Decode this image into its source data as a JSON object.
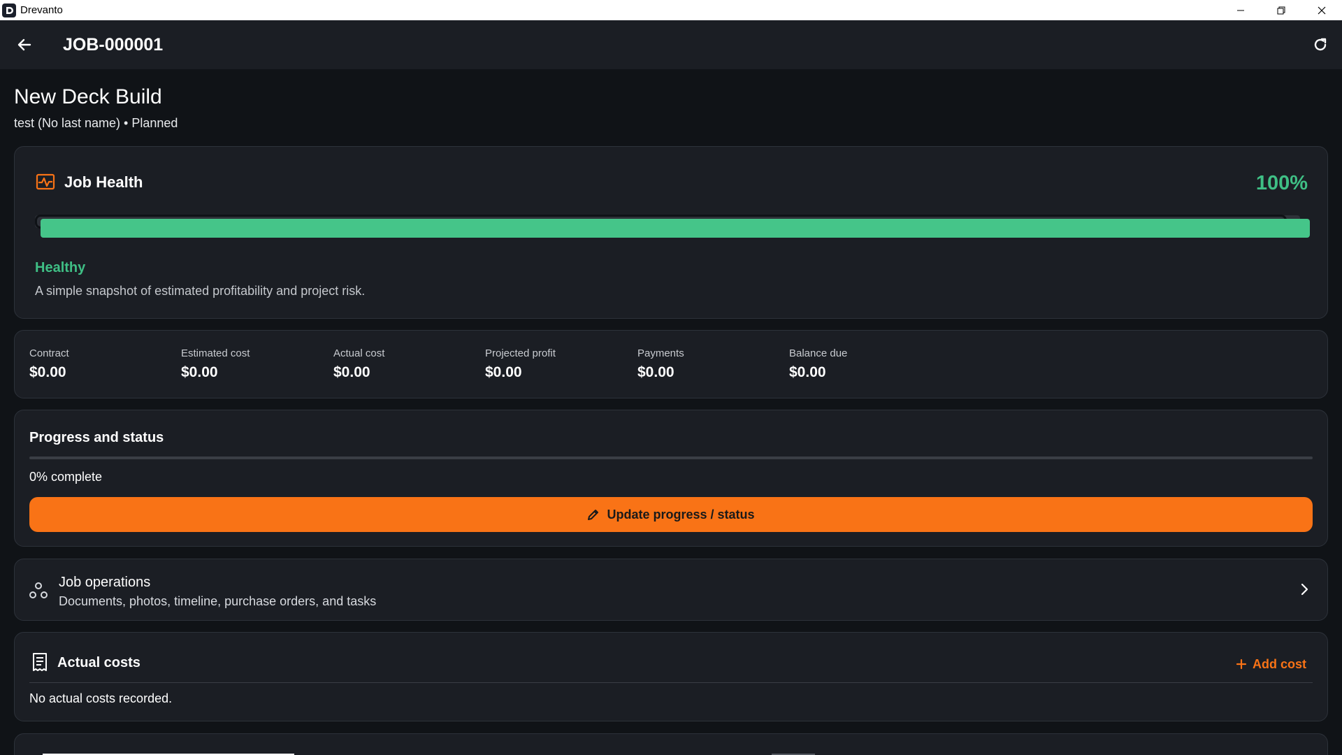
{
  "window": {
    "app_name": "Drevanto"
  },
  "appbar": {
    "title": "JOB-000001"
  },
  "job": {
    "name": "New Deck Build",
    "subtitle": "test (No last name) • Planned"
  },
  "health": {
    "title": "Job Health",
    "percent_label": "100%",
    "percent_value": 100,
    "state": "Healthy",
    "description": "A simple snapshot of estimated profitability and project risk.",
    "colors": {
      "accent": "#f97316",
      "good": "#45c589"
    }
  },
  "financials": [
    {
      "label": "Contract",
      "value": "$0.00"
    },
    {
      "label": "Estimated cost",
      "value": "$0.00"
    },
    {
      "label": "Actual cost",
      "value": "$0.00"
    },
    {
      "label": "Projected profit",
      "value": "$0.00"
    },
    {
      "label": "Payments",
      "value": "$0.00"
    },
    {
      "label": "Balance due",
      "value": "$0.00"
    }
  ],
  "progress": {
    "title": "Progress and status",
    "percent_value": 0,
    "complete_label": "0% complete",
    "update_button": "Update progress / status"
  },
  "operations": {
    "title": "Job operations",
    "subtitle": "Documents, photos, timeline, purchase orders, and tasks"
  },
  "actual_costs": {
    "title": "Actual costs",
    "add_button": "Add cost",
    "empty_message": "No actual costs recorded."
  },
  "icons": {
    "back": "arrow-left-icon",
    "refresh": "refresh-icon",
    "health": "health-pulse-icon",
    "operations": "nodes-icon",
    "chevron": "chevron-right-icon",
    "receipt": "receipt-icon",
    "add": "plus-icon",
    "edit": "pencil-icon"
  }
}
